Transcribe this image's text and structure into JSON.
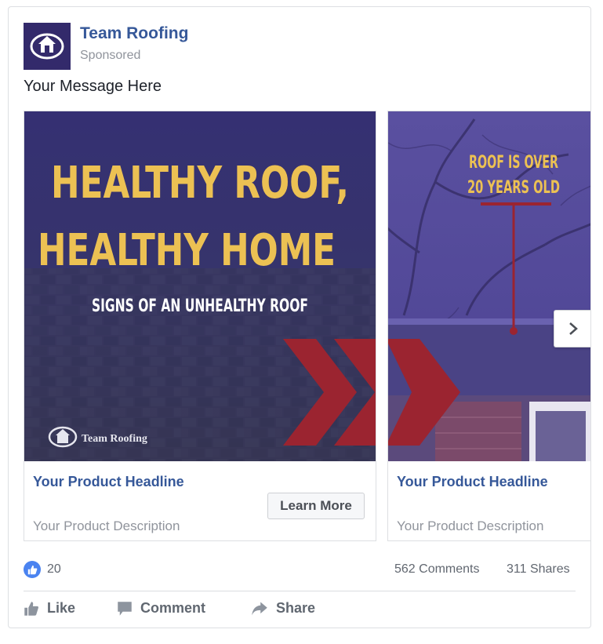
{
  "post": {
    "page_name": "Team Roofing",
    "sponsored_label": "Sponsored",
    "message": "Your Message Here"
  },
  "cards": [
    {
      "image": {
        "line1": "HEALTHY ROOF,",
        "line2": "HEALTHY HOME",
        "subtitle": "SIGNS OF AN UNHEALTHY ROOF",
        "logo_text": "Team Roofing"
      },
      "headline": "Your Product Headline",
      "description": "Your Product Description",
      "cta": "Learn More"
    },
    {
      "image": {
        "line1": "ROOF IS OVER",
        "line2": "20 YEARS OLD"
      },
      "headline": "Your Product Headline",
      "description": "Your Product Description"
    }
  ],
  "stats": {
    "reactions": "20",
    "comments": "562 Comments",
    "shares": "311 Shares"
  },
  "actions": {
    "like": "Like",
    "comment": "Comment",
    "share": "Share"
  },
  "icons": {
    "avatar": "house-logo-icon",
    "next": "chevron-right-icon",
    "reaction": "thumbs-up-icon",
    "like": "thumbs-up-icon",
    "comment": "comment-icon",
    "share": "share-arrow-icon"
  },
  "colors": {
    "brand": "#332a6b",
    "link": "#365899",
    "headline_yellow": "#ecc153",
    "chevron_red": "#9b2430",
    "like_blue": "#4a83f0"
  }
}
